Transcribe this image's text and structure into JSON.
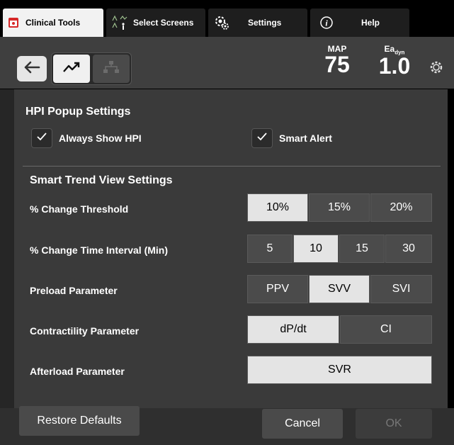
{
  "tabs": [
    {
      "label": "Clinical Tools",
      "icon": "clinical-tools-icon"
    },
    {
      "label": "Select Screens",
      "icon": "select-screens-icon"
    },
    {
      "label": "Settings",
      "icon": "settings-gear-icon"
    },
    {
      "label": "Help",
      "icon": "info-icon"
    }
  ],
  "header": {
    "metrics": [
      {
        "label": "MAP",
        "value": "75"
      },
      {
        "label": "Ea",
        "sub": "dyn",
        "value": "1.0"
      }
    ]
  },
  "hpi": {
    "title": "HPI Popup Settings",
    "always_show": "Always Show HPI",
    "smart_alert": "Smart Alert"
  },
  "trend": {
    "title": "Smart Trend View Settings",
    "rows": [
      {
        "label": "% Change Threshold",
        "options": [
          "10%",
          "15%",
          "20%"
        ],
        "selected": "10%"
      },
      {
        "label": "% Change Time Interval (Min)",
        "options": [
          "5",
          "10",
          "15",
          "30"
        ],
        "selected": "10"
      },
      {
        "label": "Preload Parameter",
        "options": [
          "PPV",
          "SVV",
          "SVI"
        ],
        "selected": "SVV"
      },
      {
        "label": "Contractility Parameter",
        "options": [
          "dP/dt",
          "CI"
        ],
        "selected": "dP/dt"
      },
      {
        "label": "Afterload Parameter",
        "options": [
          "SVR"
        ],
        "selected": "SVR"
      }
    ]
  },
  "buttons": {
    "restore": "Restore Defaults",
    "cancel": "Cancel",
    "ok": "OK"
  },
  "colors": {
    "selected": "#e4e4e4",
    "unselected": "#4b4b4b",
    "panel": "#3a3a3a",
    "header": "#3f3f3f",
    "alert_red": "#d62828"
  }
}
